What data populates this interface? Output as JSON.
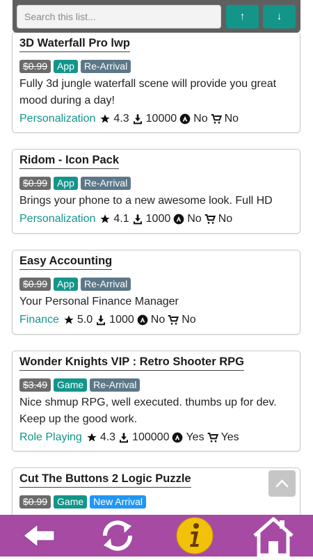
{
  "search": {
    "placeholder": "Search this list...",
    "value": ""
  },
  "sort": {
    "up_label": "↑",
    "down_label": "↓"
  },
  "apps": [
    {
      "title": "3D Waterfall Pro lwp",
      "price": "$0.99",
      "type": "App",
      "arrival": "Re-Arrival",
      "description": "Fully 3d jungle waterfall scene will provide you great mood during a day!",
      "category": "Personalization",
      "rating": "4.3",
      "downloads": "10000",
      "ads": "No",
      "iap": "No"
    },
    {
      "title": "Ridom - Icon Pack",
      "price": "$0.99",
      "type": "App",
      "arrival": "Re-Arrival",
      "description": "Brings your phone to a new awesome look. Full HD",
      "category": "Personalization",
      "rating": "4.1",
      "downloads": "1000",
      "ads": "No",
      "iap": "No"
    },
    {
      "title": "Easy Accounting",
      "price": "$0.99",
      "type": "App",
      "arrival": "Re-Arrival",
      "description": "Your Personal Finance Manager",
      "category": "Finance",
      "rating": "5.0",
      "downloads": "1000",
      "ads": "No",
      "iap": "No"
    },
    {
      "title": "Wonder Knights VIP : Retro Shooter RPG",
      "price": "$3.49",
      "type": "Game",
      "arrival": "Re-Arrival",
      "description": "Nice shmup RPG, well executed. thumbs up for dev. Keep up the good work.",
      "category": "Role Playing",
      "rating": "4.3",
      "downloads": "100000",
      "ads": "Yes",
      "iap": "Yes"
    },
    {
      "title": "Cut The Buttons 2 Logic Puzzle",
      "price": "$0.99",
      "type": "Game",
      "arrival": "New Arrival"
    }
  ],
  "colors": {
    "accent": "#13958a",
    "price_badge": "#6b6b6b",
    "arrival_badge": "#5c7788",
    "new_badge": "#2196f3",
    "bottom_bar": "#a64aa4",
    "info_button": "#f2c10a"
  },
  "icons": {
    "rating": "star-icon",
    "downloads": "download-icon",
    "ads": "ads-icon",
    "iap": "cart-icon",
    "nav": [
      "back-arrow-icon",
      "refresh-icon",
      "info-icon",
      "home-icon"
    ]
  }
}
